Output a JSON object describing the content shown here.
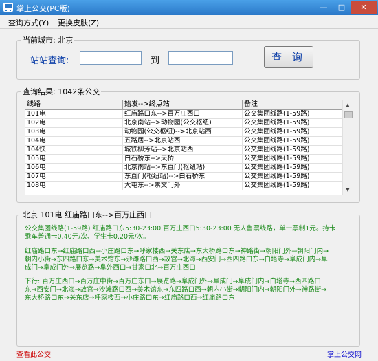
{
  "window": {
    "title": "掌上公交(PC版)",
    "minimize": "—",
    "maximize": "□",
    "close": "✕"
  },
  "menu": [
    {
      "label": "查询方式(Y)"
    },
    {
      "label": "更换皮肤(Z)"
    }
  ],
  "search": {
    "city_legend": "当前城市: 北京",
    "label": "站站查询:",
    "from_value": "",
    "to_label": "到",
    "to_value": "",
    "button": "查 询"
  },
  "results": {
    "legend": "查询结果: 1042条公交",
    "columns": [
      "线路",
      "始发-->终点站",
      "备注"
    ],
    "rows": [
      [
        "101电",
        "红庙路口东-->百万庄西口",
        "公交集团线路(1-59路)"
      ],
      [
        "102电",
        "北京南站-->动物园(公交枢纽)",
        "公交集团线路(1-59路)"
      ],
      [
        "103电",
        "动物园(公交枢纽)-->北京站西",
        "公交集团线路(1-59路)"
      ],
      [
        "104电",
        "五路居-->北京站西",
        "公交集团线路(1-59路)"
      ],
      [
        "104快",
        "城铁柳芳站-->北京站西",
        "公交集团线路(1-59路)"
      ],
      [
        "105电",
        "白石桥东-->天桥",
        "公交集团线路(1-59路)"
      ],
      [
        "106电",
        "北京南站-->东直门(枢纽站)",
        "公交集团线路(1-59路)"
      ],
      [
        "107电",
        "东直门(枢纽站)-->白石桥东",
        "公交集团线路(1-59路)"
      ],
      [
        "108电",
        "大屯东-->崇文门外",
        "公交集团线路(1-59路)"
      ]
    ]
  },
  "detail": {
    "legend": "北京 101电     红庙路口东-->百万庄西口",
    "info_line1": "公交集团线路(1-59路)      红庙路口东5:30-23:00  百万庄西口5:30-23:00      无人售票线路，单一票制1元。持卡",
    "info_line2": "乘车普通卡0.40元/次、学生卡0.20元/次。",
    "up_line1": "红庙路口东→红庙路口西→小庄路口东→呼家楼西→关东店→东大桥路口东→神路街→朝阳门外→朝阳门内→",
    "up_line2": "朝内小街→东四路口东→美术馆东→沙滩路口西→故宫→北海→西安门→西四路口东→白塔寺→阜成门内→阜",
    "up_line3": "成门→阜成门外→展览路→阜外西口→甘家口北→百万庄西口",
    "down_line1": "下行:   百万庄西口→百万庄中街→百万庄东口→展览路→阜成门外→阜成门→阜成门内→白塔寺→西四路口",
    "down_line2": "东→西安门→北海→故宫→沙滩路口西→美术馆东→东四路口西→朝内小街→朝阳门内→朝阳门外→神路街→",
    "down_line3": "东大桥路口东→关东店→呼家楼西→小庄路口东→红庙路口西→红庙路口东"
  },
  "links": {
    "view": "查看此公交",
    "site": "掌上公交网"
  },
  "icons": {
    "app": "bus-icon"
  },
  "colors": {
    "label_blue": "#0d3fa8",
    "route_green": "#1a8a1a",
    "link_red": "#cc0000",
    "link_blue": "#0000cc"
  }
}
